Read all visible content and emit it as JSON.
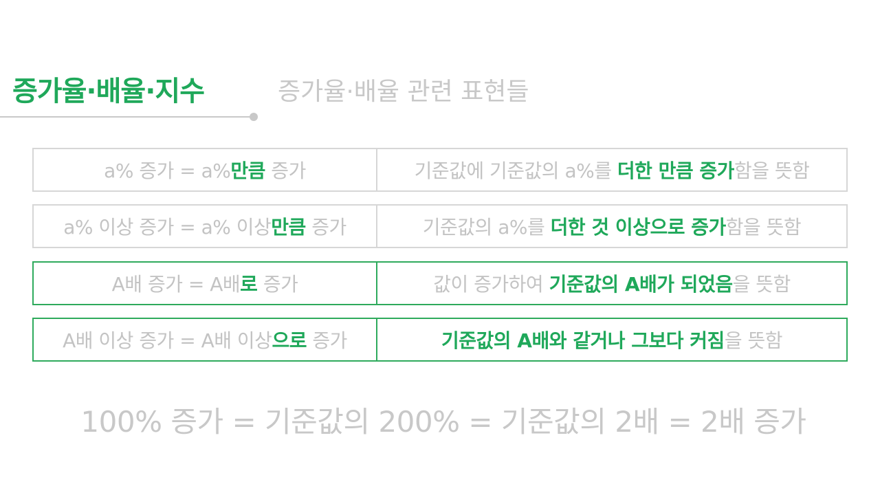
{
  "header": {
    "title": "증가율·배율·지수",
    "subtitle": "증가율·배율 관련 표현들"
  },
  "rows": [
    {
      "left": {
        "a": "a% 증가 = a%",
        "hl": "만큼",
        "b": " 증가"
      },
      "right": {
        "a": "기준값에 기준값의 a%를 ",
        "hl": "더한 만큼 증가",
        "b": "함을 뜻함"
      }
    },
    {
      "left": {
        "a": "a% 이상 증가 = a% 이상",
        "hl": "만큼",
        "b": " 증가"
      },
      "right": {
        "a": "기준값의 a%를 ",
        "hl": "더한 것 이상으로 증가",
        "b": "함을 뜻함"
      }
    },
    {
      "left": {
        "a": "A배 증가 = A배",
        "hl": "로",
        "b": " 증가"
      },
      "right": {
        "a": "값이 증가하여 ",
        "hl": "기준값의 A배가 되었음",
        "b": "을 뜻함"
      }
    },
    {
      "left": {
        "a": "A배 이상 증가 = A배 이상",
        "hl": "으로",
        "b": " 증가"
      },
      "right": {
        "a": "",
        "hl": "기준값의 A배와 같거나 그보다 커짐",
        "b": "을 뜻함"
      }
    }
  ],
  "footer": "100% 증가 = 기준값의 200% = 기준값의 2배 = 2배 증가",
  "colors": {
    "accent": "#1fa85a",
    "muted_text": "#c3c3c3",
    "border_gray": "#d6d6d6",
    "border_green": "#2eaa5c"
  }
}
